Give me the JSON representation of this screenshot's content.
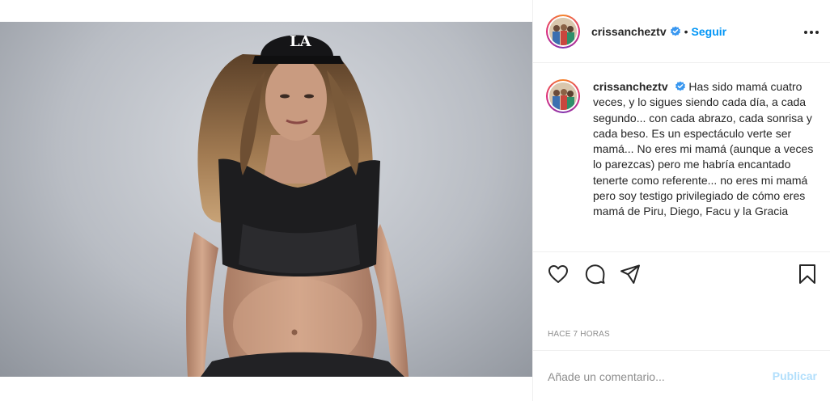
{
  "post": {
    "username": "crissancheztv",
    "follow_label": "Seguir",
    "separator": "•",
    "caption_text": "Has sido mamá cuatro veces, y lo sigues siendo cada día, a cada segundo... con cada abrazo, cada sonrisa y cada beso. Es un espectáculo verte ser mamá... No eres mi mamá (aunque a veces lo parezcas) pero me habría encantado tenerte como referente... no eres mi mamá pero soy testigo privilegiado de cómo eres mamá de Piru, Diego, Facu y la Gracia",
    "time_ago": "HACE 7 HORAS",
    "cap_logo": "LA"
  },
  "comment": {
    "placeholder": "Añade un comentario...",
    "publish_label": "Publicar"
  },
  "icons": {
    "verified": "verified-badge-icon",
    "more": "more-options-icon",
    "like": "heart-icon",
    "comment": "comment-bubble-icon",
    "share": "paper-plane-icon",
    "save": "bookmark-icon"
  },
  "colors": {
    "accent": "#0095f6",
    "publish_disabled": "#b2dffc",
    "muted": "#8e8e8e",
    "text": "#262626"
  }
}
